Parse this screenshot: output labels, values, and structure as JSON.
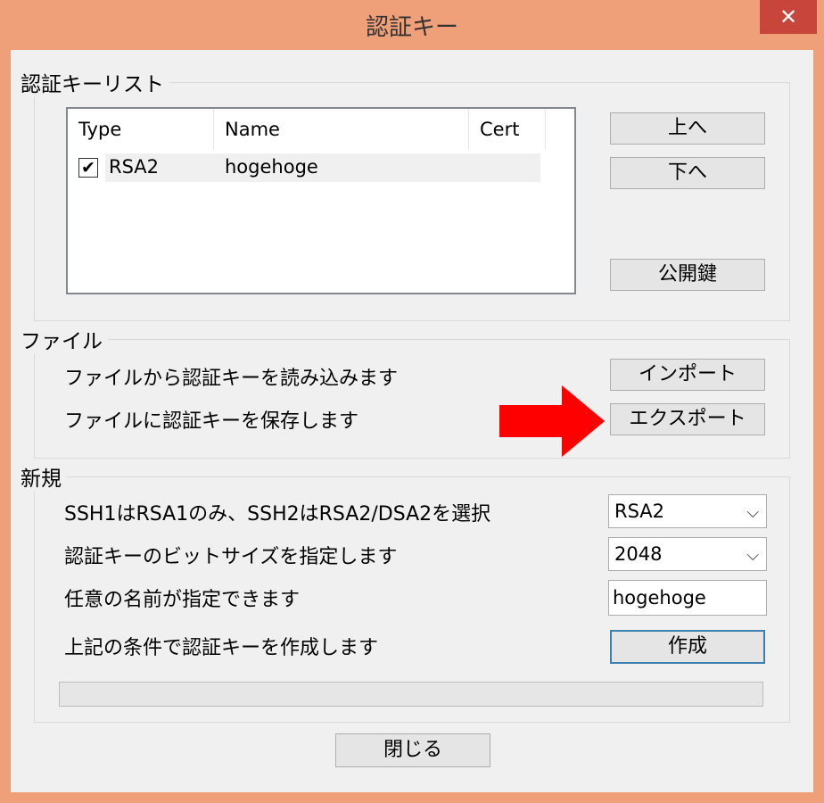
{
  "window": {
    "title": "認証キー",
    "close_label": "✕"
  },
  "keylist": {
    "group_label": "認証キーリスト",
    "columns": [
      "Type",
      "Name",
      "Cert"
    ],
    "rows": [
      {
        "checked": true,
        "type": "RSA2",
        "name": "hogehoge",
        "cert": ""
      }
    ],
    "up_label": "上へ",
    "down_label": "下へ",
    "pubkey_label": "公開鍵"
  },
  "file": {
    "group_label": "ファイル",
    "import_text": "ファイルから認証キーを読み込みます",
    "export_text": "ファイルに認証キーを保存します",
    "import_label": "インポート",
    "export_label": "エクスポート"
  },
  "new": {
    "group_label": "新規",
    "type_text": "SSH1はRSA1のみ、SSH2はRSA2/DSA2を選択",
    "bits_text": "認証キーのビットサイズを指定します",
    "name_text": "任意の名前が指定できます",
    "create_text": "上記の条件で認証キーを作成します",
    "type_value": "RSA2",
    "bits_value": "2048",
    "name_value": "hogehoge",
    "create_label": "作成",
    "progress": 0
  },
  "footer": {
    "close_label": "閉じる"
  },
  "annotation": {
    "arrow_color": "#FF0000"
  }
}
